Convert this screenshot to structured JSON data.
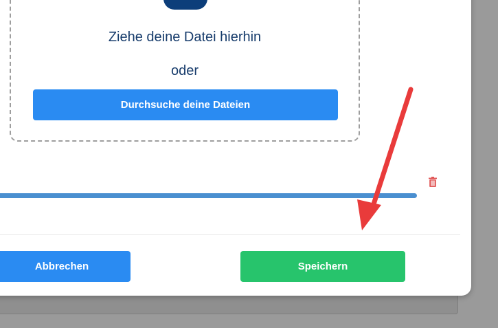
{
  "dropzone": {
    "icon": "upload-icon",
    "title": "Ziehe deine Datei hierhin",
    "or_text": "oder",
    "browse_label": "Durchsuche deine Dateien"
  },
  "upload": {
    "progress": 1.0,
    "delete_icon": "trash-icon"
  },
  "footer": {
    "cancel_label": "Abbrechen",
    "save_label": "Speichern"
  },
  "annotation": {
    "icon": "red-arrow-icon",
    "color": "#e93b3b"
  },
  "colors": {
    "primary": "#2a8bf2",
    "success": "#27c46c",
    "dark_blue": "#163b6b",
    "danger": "#e05555"
  }
}
